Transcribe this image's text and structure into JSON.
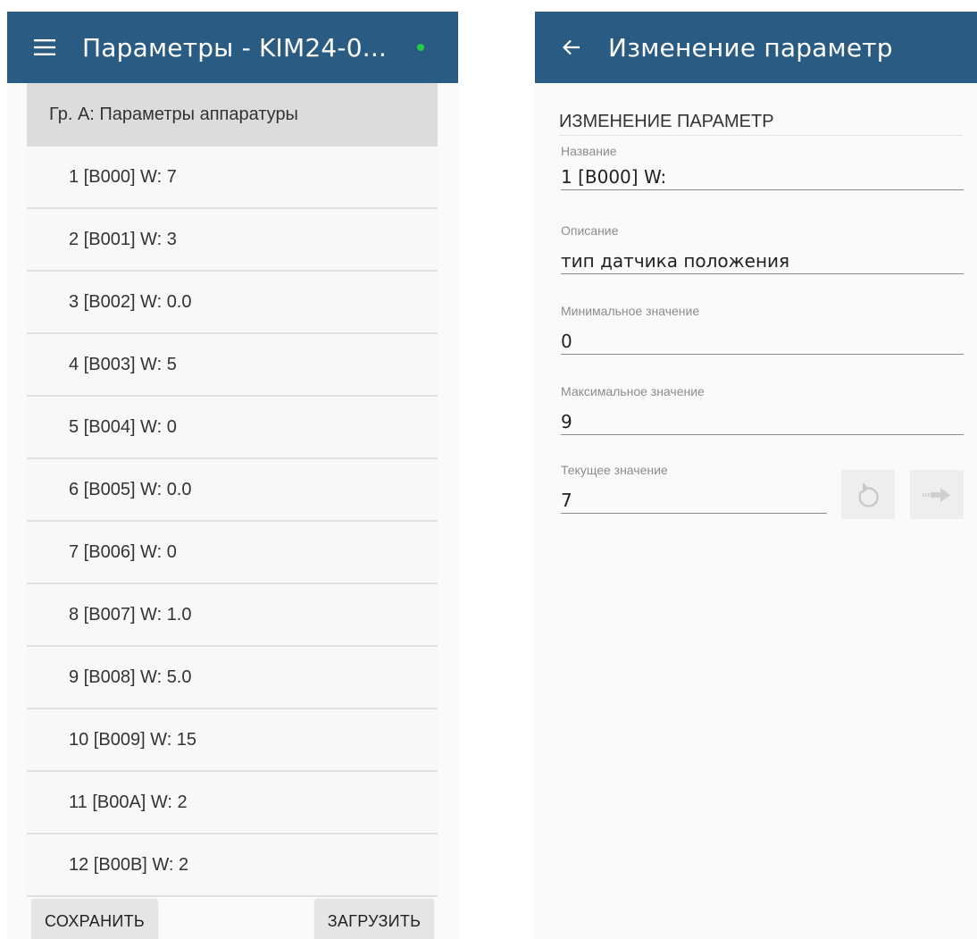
{
  "left_screen": {
    "appbar": {
      "title": "Параметры - KIM24-0...",
      "status_color": "#22cc44"
    },
    "group_header": "Гр. А: Параметры аппаратуры",
    "params": [
      "1 [B000] W:  7",
      "2 [B001] W:  3",
      "3 [B002] W:  0.0",
      "4 [B003] W:  5",
      "5 [B004] W:  0",
      "6 [B005] W:  0.0",
      "7 [B006] W:  0",
      "8 [B007] W:  1.0",
      "9 [B008] W:  5.0",
      "10 [B009] W:  15",
      "11 [B00A] W:  2",
      "12 [B00B] W:  2"
    ],
    "buttons": {
      "save": "СОХРАНИТЬ",
      "load": "ЗАГРУЗИТЬ"
    }
  },
  "right_screen": {
    "appbar": {
      "title": "Изменение параметр"
    },
    "section_title": "ИЗМЕНЕНИЕ ПАРАМЕТР",
    "fields": {
      "name": {
        "label": "Название",
        "value": "1 [B000] W:"
      },
      "description": {
        "label": "Описание",
        "value": "тип датчика положения"
      },
      "min": {
        "label": "Минимальное значение",
        "value": "0"
      },
      "max": {
        "label": "Максимальное значение",
        "value": "9"
      },
      "current": {
        "label": "Текущее значение",
        "value": "7"
      }
    },
    "icons": {
      "reset": "undo-icon",
      "send": "arrow-right-icon"
    }
  },
  "colors": {
    "appbar": "#2a5b82",
    "group_header_bg": "#dcdcdc",
    "background": "#fafafa"
  }
}
